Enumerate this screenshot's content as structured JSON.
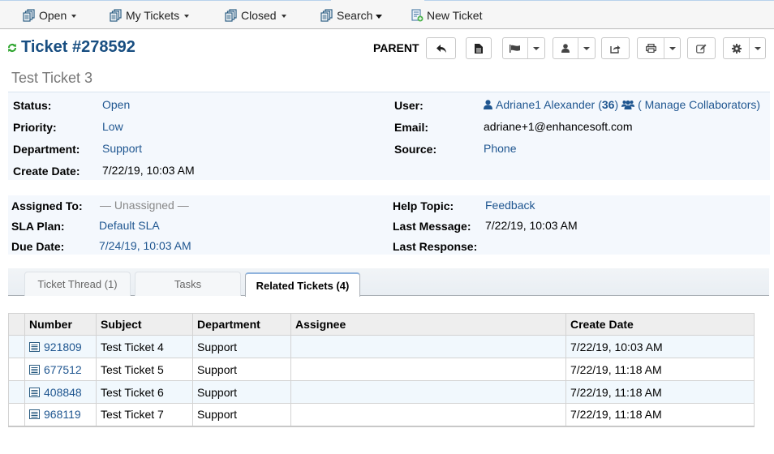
{
  "nav": {
    "items": [
      {
        "label": "Open",
        "icon": "tickets-icon",
        "has_dropdown": true
      },
      {
        "label": "My Tickets",
        "icon": "tickets-icon",
        "has_dropdown": true
      },
      {
        "label": "Closed",
        "icon": "tickets-icon",
        "has_dropdown": true
      },
      {
        "label": "Search",
        "icon": "tickets-icon",
        "has_dropdown": true
      },
      {
        "label": "New Ticket",
        "icon": "new-ticket-icon",
        "has_dropdown": false
      }
    ]
  },
  "header": {
    "title": "Ticket #278592",
    "subject": "Test Ticket 3",
    "parent_label": "PARENT",
    "actions": [
      {
        "name": "reply",
        "icon": "reply-icon"
      },
      {
        "name": "view-pdf",
        "icon": "document-icon"
      },
      {
        "name": "change-status",
        "icon": "flag-icon",
        "dropdown": true
      },
      {
        "name": "assign",
        "icon": "user-icon",
        "dropdown": true
      },
      {
        "name": "transfer",
        "icon": "share-icon"
      },
      {
        "name": "print",
        "icon": "print-icon",
        "dropdown": true
      },
      {
        "name": "edit",
        "icon": "edit-icon"
      },
      {
        "name": "more",
        "icon": "gear-icon",
        "dropdown": true
      }
    ]
  },
  "details": {
    "status": {
      "label": "Status:",
      "value": "Open"
    },
    "priority": {
      "label": "Priority:",
      "value": "Low"
    },
    "department": {
      "label": "Department:",
      "value": "Support"
    },
    "create_date": {
      "label": "Create Date:",
      "value": "7/22/19, 10:03 AM"
    },
    "user": {
      "label": "User:",
      "name": "Adriane1 Alexander",
      "count_open": "(",
      "count": "36",
      "count_close": ")",
      "collaborators": "( Manage Collaborators)"
    },
    "email": {
      "label": "Email:",
      "value": "adriane+1@enhancesoft.com"
    },
    "source": {
      "label": "Source:",
      "value": "Phone"
    },
    "assigned_to": {
      "label": "Assigned To:",
      "value": "— Unassigned —"
    },
    "sla_plan": {
      "label": "SLA Plan:",
      "value": "Default SLA"
    },
    "due_date": {
      "label": "Due Date:",
      "value": "7/24/19, 10:03 AM"
    },
    "help_topic": {
      "label": "Help Topic:",
      "value": "Feedback"
    },
    "last_message": {
      "label": "Last Message:",
      "value": "7/22/19, 10:03 AM"
    },
    "last_response": {
      "label": "Last Response:",
      "value": ""
    }
  },
  "tabs": [
    {
      "label": "Ticket Thread (1)",
      "active": false
    },
    {
      "label": "Tasks",
      "active": false
    },
    {
      "label": "Related Tickets (4)",
      "active": true
    }
  ],
  "related": {
    "columns": [
      "",
      "Number",
      "Subject",
      "Department",
      "Assignee",
      "Create Date"
    ],
    "rows": [
      {
        "number": "921809",
        "subject": "Test Ticket 4",
        "department": "Support",
        "assignee": "",
        "create_date": "7/22/19, 10:03 AM"
      },
      {
        "number": "677512",
        "subject": "Test Ticket 5",
        "department": "Support",
        "assignee": "",
        "create_date": "7/22/19, 11:18 AM"
      },
      {
        "number": "408848",
        "subject": "Test Ticket 6",
        "department": "Support",
        "assignee": "",
        "create_date": "7/22/19, 11:18 AM"
      },
      {
        "number": "968119",
        "subject": "Test Ticket 7",
        "department": "Support",
        "assignee": "",
        "create_date": "7/22/19, 11:18 AM"
      }
    ]
  },
  "colors": {
    "link": "#1f5690",
    "title": "#184e81",
    "refresh": "#2fa52f",
    "panel_bg": "#f4f8fd",
    "row_alt_bg": "#f1f8fd"
  }
}
